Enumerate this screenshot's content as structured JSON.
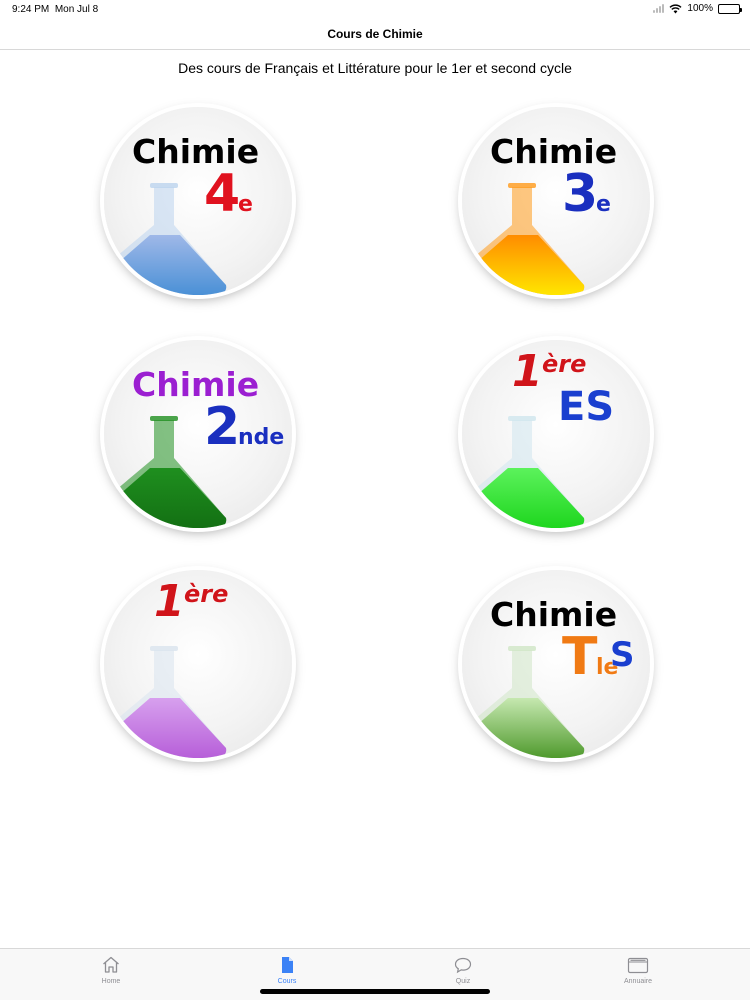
{
  "status": {
    "time": "9:24 PM",
    "date": "Mon Jul 8",
    "battery": "100%"
  },
  "nav": {
    "title": "Cours de Chimie"
  },
  "subtitle": "Des cours de Français et Littérature pour le 1er et second cycle",
  "courses": [
    {
      "word": "Chimie",
      "level": "4",
      "sup": "e",
      "word_color": "#000000",
      "level_color": "#e0121f",
      "liquid_top": "#9fb8e8",
      "liquid_bottom": "#4a90d6",
      "glass": "#bcd3ee"
    },
    {
      "word": "Chimie",
      "level": "3",
      "sup": "e",
      "word_color": "#000000",
      "level_color": "#1a2fbf",
      "liquid_top": "#ff8c00",
      "liquid_bottom": "#ffe600",
      "glass": "#ff9a1a"
    },
    {
      "word": "Chimie",
      "level": "2",
      "sup": "nde",
      "word_color": "#9b1fd1",
      "level_color": "#1a2fbf",
      "liquid_top": "#1f8f1f",
      "liquid_bottom": "#137013",
      "glass": "#1f8f1f"
    },
    {
      "word": "1",
      "sup": "ère",
      "level": "ES",
      "word_color": "#d0141a",
      "level_color": "#1a3fcf",
      "liquid_top": "#5cf25c",
      "liquid_bottom": "#1ed61e",
      "glass": "#cfe6ee"
    },
    {
      "word": "1",
      "sup": "ère",
      "word_color": "#d0141a",
      "liquid_top": "#d7a0ee",
      "liquid_bottom": "#b75fd9",
      "glass": "#d9e3ee"
    },
    {
      "word": "Chimie",
      "level": "T",
      "sup": "le",
      "level2": "S",
      "word_color": "#000000",
      "level_color": "#f07a14",
      "level2_color": "#1a3fcf",
      "liquid_top": "#c6e8b0",
      "liquid_bottom": "#4f9a2d",
      "glass": "#cfe6c6"
    }
  ],
  "tabs": [
    {
      "label": "Home",
      "icon": "house-icon"
    },
    {
      "label": "Cours",
      "icon": "document-icon",
      "active": true
    },
    {
      "label": "Quiz",
      "icon": "speech-bubble-icon"
    },
    {
      "label": "Annuaire",
      "icon": "folder-icon"
    }
  ]
}
